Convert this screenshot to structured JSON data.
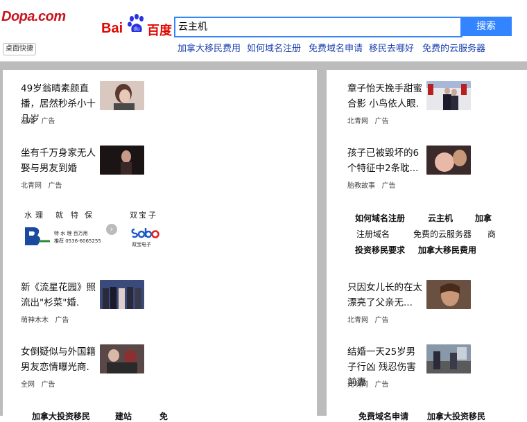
{
  "site": {
    "logo": "Dopa.com",
    "shortcut": "桌面快捷"
  },
  "baidu": {
    "logo_left": "Bai",
    "logo_mid": "du",
    "logo_right": "百度"
  },
  "search": {
    "value": "云主机",
    "button": "搜索"
  },
  "hotlinks": [
    "加拿大移民费用",
    "如何域名注册",
    "免费域名申请",
    "移民去哪好",
    "免费的云服务器"
  ],
  "left_cards": [
    {
      "title": "49岁翁晴素颜直播，居然秒杀小十几岁",
      "source": "温翔",
      "src_tag": "广告"
    },
    {
      "title": "坐有千万身家无人娶与男友到婚",
      "source": "北青网",
      "src_tag": "广告"
    },
    {
      "title": "新《流星花园》照流出\"杉菜\"婚.",
      "source": "萌神木木",
      "src_tag": "广告"
    },
    {
      "title": "女倒疑似与外国籍男友恋情曝光商.",
      "source": "全网",
      "src_tag": "广告"
    }
  ],
  "right_cards": [
    {
      "title": "章子怡天挽手甜蜜合影 小鸟依人眼.",
      "source": "北青网",
      "src_tag": "广告"
    },
    {
      "title": "孩子已被毁坏的6个特征中2条耽...",
      "source": "胎教故事",
      "src_tag": "广告"
    },
    {
      "title": "只因女儿长的在太漂亮了父亲无...",
      "source": "北青网",
      "src_tag": "广告"
    },
    {
      "title": "结婚一天25岁男子行凶 残忍伤害前妻",
      "source": "光明网",
      "src_tag": "广告"
    }
  ],
  "ad_block": {
    "left_words": [
      "水",
      "理",
      "就",
      "特",
      "保"
    ],
    "right_words": [
      "双",
      "宝",
      "子"
    ],
    "left_caption": "特 水 理 百万用",
    "left_caption2": "推荐 0536-6065255",
    "right_caption": "双宝电子"
  },
  "keyword_rows": [
    {
      "items": [
        "如何域名注册",
        "云主机",
        "加拿"
      ],
      "bold": true
    },
    {
      "items": [
        "注册域名",
        "免费的云服务器",
        "商"
      ],
      "bold": false
    },
    {
      "items": [
        "投资移民要求",
        "加拿大移民费用"
      ],
      "bold": false
    }
  ],
  "bottom_rows": {
    "left": [
      "加拿大投资移民",
      "建站",
      "免"
    ],
    "right": [
      "免费域名申请",
      "加拿大投资移民"
    ]
  },
  "colors": {
    "brand_red": "#c8141e",
    "baidu_blue": "#3385ff",
    "link_blue": "#1a3ead",
    "gutter": "#bcbcbc"
  }
}
